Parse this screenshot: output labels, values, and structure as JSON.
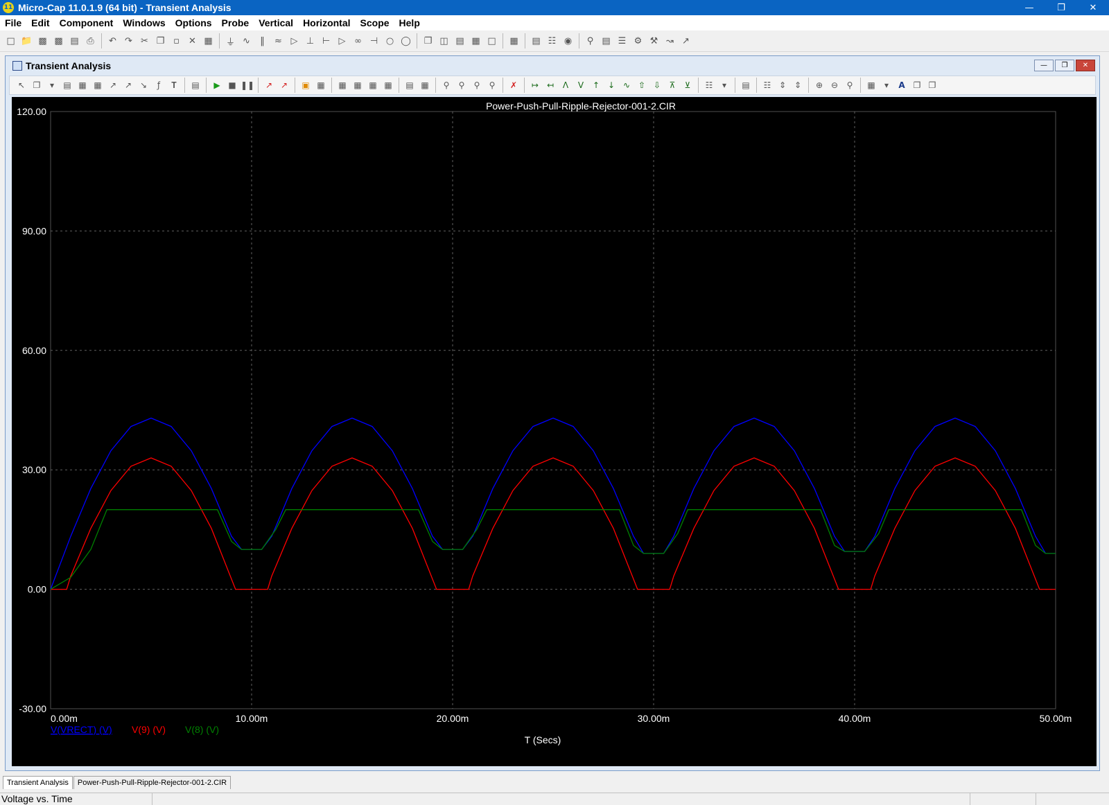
{
  "app": {
    "title": "Micro-Cap 11.0.1.9 (64 bit) - Transient Analysis",
    "icon_glyph": "11",
    "window_buttons": [
      "minimize-icon",
      "restore-icon",
      "close-icon"
    ]
  },
  "menu": [
    "File",
    "Edit",
    "Component",
    "Windows",
    "Options",
    "Probe",
    "Vertical",
    "Horizontal",
    "Scope",
    "Help"
  ],
  "child_window": {
    "title": "Transient Analysis"
  },
  "chart_data": {
    "type": "line",
    "title": "Power-Push-Pull-Ripple-Rejector-001-2.CIR",
    "xlabel": "T (Secs)",
    "ylabel": "",
    "xlim": [
      0,
      0.05
    ],
    "ylim": [
      -30,
      120
    ],
    "grid": true,
    "x_ticks": [
      "0.00m",
      "10.00m",
      "20.00m",
      "30.00m",
      "40.00m",
      "50.00m"
    ],
    "y_ticks": [
      "120.00",
      "90.00",
      "60.00",
      "30.00",
      "0.00",
      "-30.00"
    ],
    "legend_placement": "bottom-left",
    "series": [
      {
        "name": "V(VRECT) (V)",
        "color": "#0000ff",
        "x": [
          0,
          0.001,
          0.002,
          0.003,
          0.004,
          0.005,
          0.006,
          0.007,
          0.008,
          0.009,
          0.0095,
          0.01,
          0.0105,
          0.011,
          0.012,
          0.013,
          0.014,
          0.015,
          0.016,
          0.017,
          0.018,
          0.019,
          0.0195,
          0.02,
          0.0205,
          0.021,
          0.022,
          0.023,
          0.024,
          0.025,
          0.026,
          0.027,
          0.028,
          0.029,
          0.0295,
          0.03,
          0.0305,
          0.031,
          0.032,
          0.033,
          0.034,
          0.035,
          0.036,
          0.037,
          0.038,
          0.039,
          0.0395,
          0.04,
          0.0405,
          0.041,
          0.042,
          0.043,
          0.044,
          0.045,
          0.046,
          0.047,
          0.048,
          0.049,
          0.0495,
          0.05
        ],
        "y": [
          0,
          13.3,
          25.3,
          34.8,
          40.9,
          43.0,
          40.9,
          34.8,
          25.3,
          13.3,
          10.0,
          10.0,
          10.0,
          13.3,
          25.3,
          34.8,
          40.9,
          43.0,
          40.9,
          34.8,
          25.3,
          13.3,
          10.0,
          10.0,
          10.0,
          13.3,
          25.3,
          34.8,
          40.9,
          43.0,
          40.9,
          34.8,
          25.3,
          13.3,
          9.0,
          9.0,
          9.0,
          13.3,
          25.3,
          34.8,
          40.9,
          43.0,
          40.9,
          34.8,
          25.3,
          13.3,
          9.5,
          9.5,
          9.5,
          13.3,
          25.3,
          34.8,
          40.9,
          43.0,
          40.9,
          34.8,
          25.3,
          13.3,
          9.0,
          9.0
        ]
      },
      {
        "name": "V(9) (V)",
        "color": "#ff0000",
        "x": [
          0,
          0.0008,
          0.001,
          0.002,
          0.003,
          0.004,
          0.005,
          0.006,
          0.007,
          0.008,
          0.0092,
          0.0108,
          0.011,
          0.012,
          0.013,
          0.014,
          0.015,
          0.016,
          0.017,
          0.018,
          0.0192,
          0.0208,
          0.021,
          0.022,
          0.023,
          0.024,
          0.025,
          0.026,
          0.027,
          0.028,
          0.0292,
          0.0308,
          0.031,
          0.032,
          0.033,
          0.034,
          0.035,
          0.036,
          0.037,
          0.038,
          0.0392,
          0.0408,
          0.041,
          0.042,
          0.043,
          0.044,
          0.045,
          0.046,
          0.047,
          0.048,
          0.0492,
          0.05
        ],
        "y": [
          0,
          0,
          3.3,
          15.3,
          24.8,
          30.9,
          33.0,
          30.9,
          24.8,
          15.3,
          0,
          0,
          3.3,
          15.3,
          24.8,
          30.9,
          33.0,
          30.9,
          24.8,
          15.3,
          0,
          0,
          3.3,
          15.3,
          24.8,
          30.9,
          33.0,
          30.9,
          24.8,
          15.3,
          0,
          0,
          3.3,
          15.3,
          24.8,
          30.9,
          33.0,
          30.9,
          24.8,
          15.3,
          0,
          0,
          3.3,
          15.3,
          24.8,
          30.9,
          33.0,
          30.9,
          24.8,
          15.3,
          0,
          0
        ]
      },
      {
        "name": "V(8) (V)",
        "color": "#008000",
        "x": [
          0,
          0.001,
          0.002,
          0.0028,
          0.0083,
          0.009,
          0.0095,
          0.0105,
          0.0112,
          0.0117,
          0.0183,
          0.019,
          0.0195,
          0.0205,
          0.0212,
          0.0217,
          0.0283,
          0.029,
          0.0295,
          0.0305,
          0.0312,
          0.0317,
          0.0383,
          0.039,
          0.0395,
          0.0405,
          0.0412,
          0.0417,
          0.0483,
          0.049,
          0.0495,
          0.05
        ],
        "y": [
          0,
          3.0,
          10.0,
          20.0,
          20.0,
          12.0,
          10.0,
          10.0,
          15.0,
          20.0,
          20.0,
          12.0,
          10.0,
          10.0,
          15.0,
          20.0,
          20.0,
          11.0,
          9.0,
          9.0,
          14.0,
          20.0,
          20.0,
          11.0,
          9.5,
          9.5,
          14.0,
          20.0,
          20.0,
          11.0,
          9.0,
          9.0
        ]
      }
    ]
  },
  "tabs": [
    "Transient Analysis",
    "Power-Push-Pull-Ripple-Rejector-001-2.CIR"
  ],
  "status": {
    "mode": "Voltage vs. Time"
  }
}
